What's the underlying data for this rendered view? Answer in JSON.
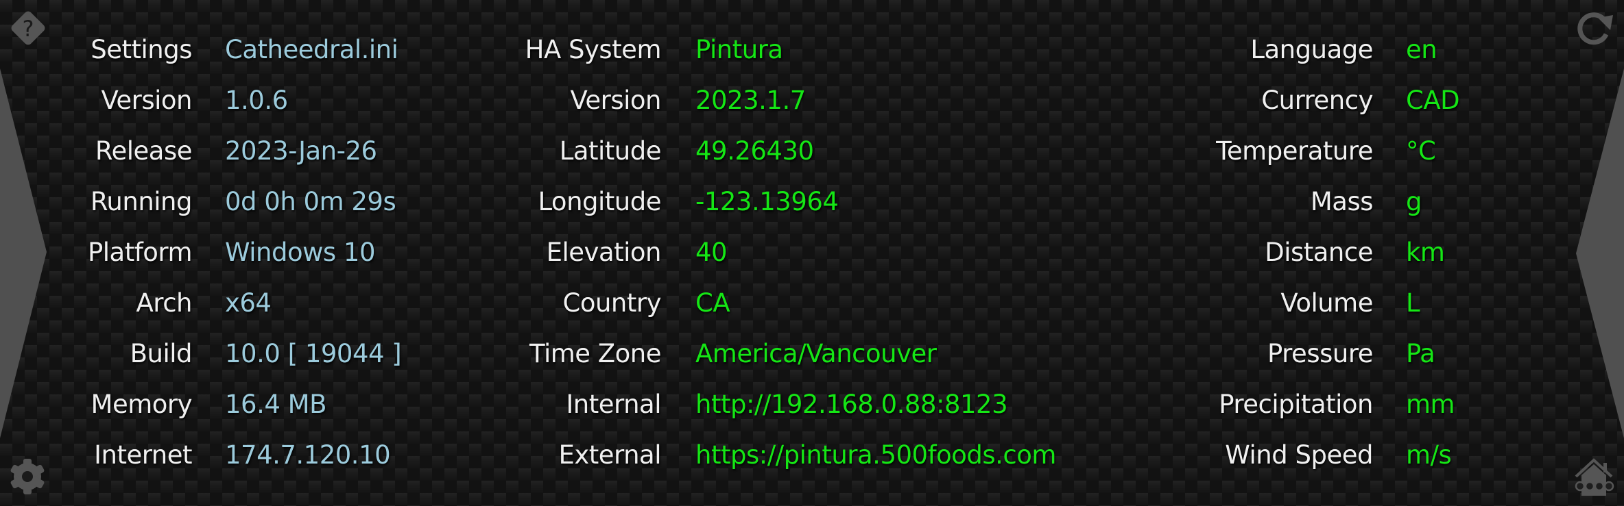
{
  "colors": {
    "label": "#f0f0f0",
    "app_value": "#9ccbdc",
    "ha_value": "#15e615",
    "icon": "#555555"
  },
  "icons": {
    "help": "help-diamond-icon",
    "refresh": "refresh-icon",
    "settings": "gear-icon",
    "home": "home-assistant-icon",
    "nav_prev": "chevron-left-tab",
    "nav_next": "chevron-right-tab"
  },
  "app_info": [
    {
      "label": "Settings",
      "value": "Catheedral.ini"
    },
    {
      "label": "Version",
      "value": "1.0.6"
    },
    {
      "label": "Release",
      "value": "2023-Jan-26"
    },
    {
      "label": "Running",
      "value": "0d 0h 0m 29s"
    },
    {
      "label": "Platform",
      "value": "Windows 10"
    },
    {
      "label": "Arch",
      "value": "x64"
    },
    {
      "label": "Build",
      "value": "10.0 [ 19044 ]"
    },
    {
      "label": "Memory",
      "value": "16.4 MB"
    },
    {
      "label": "Internet",
      "value": "174.7.120.10"
    }
  ],
  "ha_info": [
    {
      "label": "HA System",
      "value": "Pintura"
    },
    {
      "label": "Version",
      "value": "2023.1.7"
    },
    {
      "label": "Latitude",
      "value": "49.26430"
    },
    {
      "label": "Longitude",
      "value": "-123.13964"
    },
    {
      "label": "Elevation",
      "value": "40"
    },
    {
      "label": "Country",
      "value": "CA"
    },
    {
      "label": "Time Zone",
      "value": "America/Vancouver"
    },
    {
      "label": "Internal",
      "value": "http://192.168.0.88:8123"
    },
    {
      "label": "External",
      "value": "https://pintura.500foods.com"
    }
  ],
  "units": [
    {
      "label": "Language",
      "value": "en"
    },
    {
      "label": "Currency",
      "value": "CAD"
    },
    {
      "label": "Temperature",
      "value": "°C"
    },
    {
      "label": "Mass",
      "value": "g"
    },
    {
      "label": "Distance",
      "value": "km"
    },
    {
      "label": "Volume",
      "value": "L"
    },
    {
      "label": "Pressure",
      "value": "Pa"
    },
    {
      "label": "Precipitation",
      "value": "mm"
    },
    {
      "label": "Wind Speed",
      "value": "m/s"
    }
  ]
}
